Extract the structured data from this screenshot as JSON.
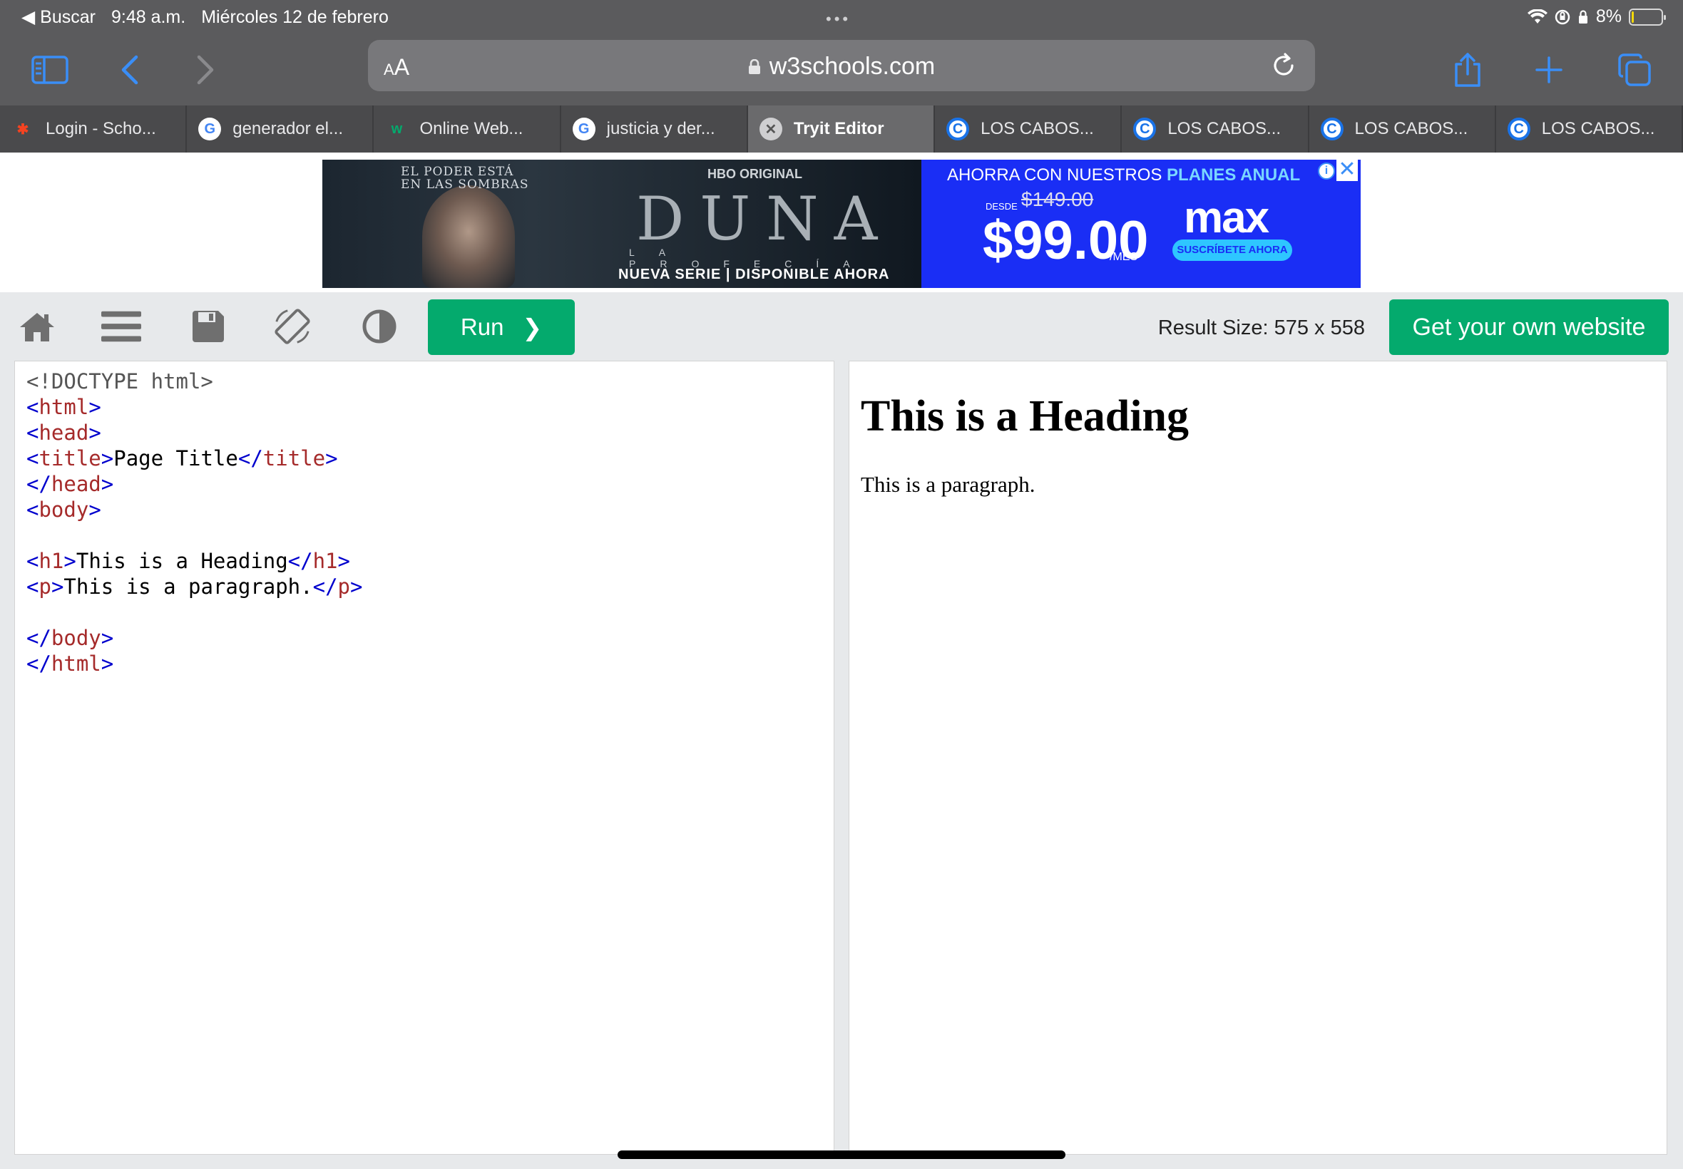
{
  "status_bar": {
    "back_app": "Buscar",
    "time": "9:48 a.m.",
    "date": "Miércoles 12 de febrero",
    "battery_percent": "8%",
    "battery_level": 0.08
  },
  "toolbar": {
    "reader_label": "AA",
    "url": "w3schools.com"
  },
  "tabs": [
    {
      "label": "Login - Scho...",
      "icon": "joomla-icon",
      "active": false
    },
    {
      "label": "generador el...",
      "icon": "google-icon",
      "active": false
    },
    {
      "label": "Online Web...",
      "icon": "w3schools-icon",
      "active": false
    },
    {
      "label": "justicia y der...",
      "icon": "google-icon",
      "active": false
    },
    {
      "label": "Tryit Editor",
      "icon": "close-icon",
      "active": true
    },
    {
      "label": "LOS CABOS...",
      "icon": "c-icon",
      "active": false
    },
    {
      "label": "LOS CABOS...",
      "icon": "c-icon",
      "active": false
    },
    {
      "label": "LOS CABOS...",
      "icon": "c-icon",
      "active": false
    },
    {
      "label": "LOS CABOS...",
      "icon": "c-icon",
      "active": false
    }
  ],
  "ad": {
    "tagline_1": "EL PODER ESTÁ",
    "tagline_2": "EN LAS SOMBRAS",
    "hbo": "HBO ORIGINAL",
    "show_title": "DUNA",
    "show_subtitle": "LA PROFECÍA",
    "availability": "NUEVA SERIE | DISPONIBLE AHORA",
    "promo_prefix": "AHORRA CON NUESTROS",
    "promo_highlight": "PLANES ANUAL",
    "desde": "DESDE",
    "old_price": "$149.00",
    "price": "$99.00",
    "per": "/MES",
    "brand": "max",
    "cta": "SUSCRÍBETE AHORA",
    "info": "i",
    "close": "✕"
  },
  "editor": {
    "run_label": "Run",
    "run_chevron": "❯",
    "result_size": "Result Size: 575 x 558",
    "get_site": "Get your own website"
  },
  "code_lines": [
    "<!DOCTYPE html>",
    "<html>",
    "<head>",
    "<title>Page Title</title>",
    "</head>",
    "<body>",
    "",
    "<h1>This is a Heading</h1>",
    "<p>This is a paragraph.</p>",
    "",
    "</body>",
    "</html>"
  ],
  "result": {
    "heading": "This is a Heading",
    "paragraph": "This is a paragraph."
  },
  "colors": {
    "accent": "#04aa6d",
    "safari_bar": "#5b5b5d",
    "ios_blue": "#3a8ef7"
  }
}
